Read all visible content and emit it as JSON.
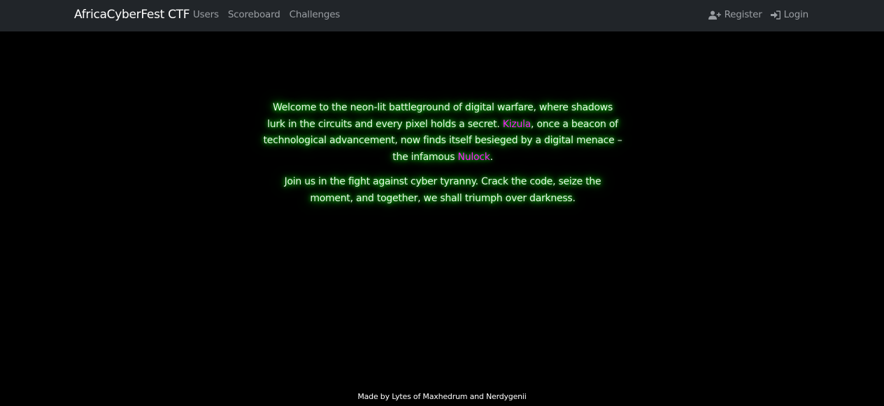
{
  "navbar": {
    "brand": "AfricaCyberFest CTF",
    "left_links": [
      "Users",
      "Scoreboard",
      "Challenges"
    ],
    "register": "Register",
    "login": "Login"
  },
  "content": {
    "p1_part1": "Welcome to the neon-lit battleground of digital warfare, where shadows lurk in the circuits and every pixel holds a secret. ",
    "highlight1": "Kizula",
    "p1_part2": ", once a beacon of technological advancement, now finds itself besieged by a digital menace – the infamous ",
    "highlight2": "Nulock",
    "p1_part3": ".",
    "p2": "Join us in the fight against cyber tyranny. Crack the code, seize the moment, and together, we shall triumph over darkness."
  },
  "footer": "Made by Lytes of Maxhedrum and Nerdygenii",
  "colors": {
    "navbar_bg": "#212529",
    "page_bg": "#000000",
    "glow": "#1aff1a",
    "highlight": "#ff1aff"
  }
}
